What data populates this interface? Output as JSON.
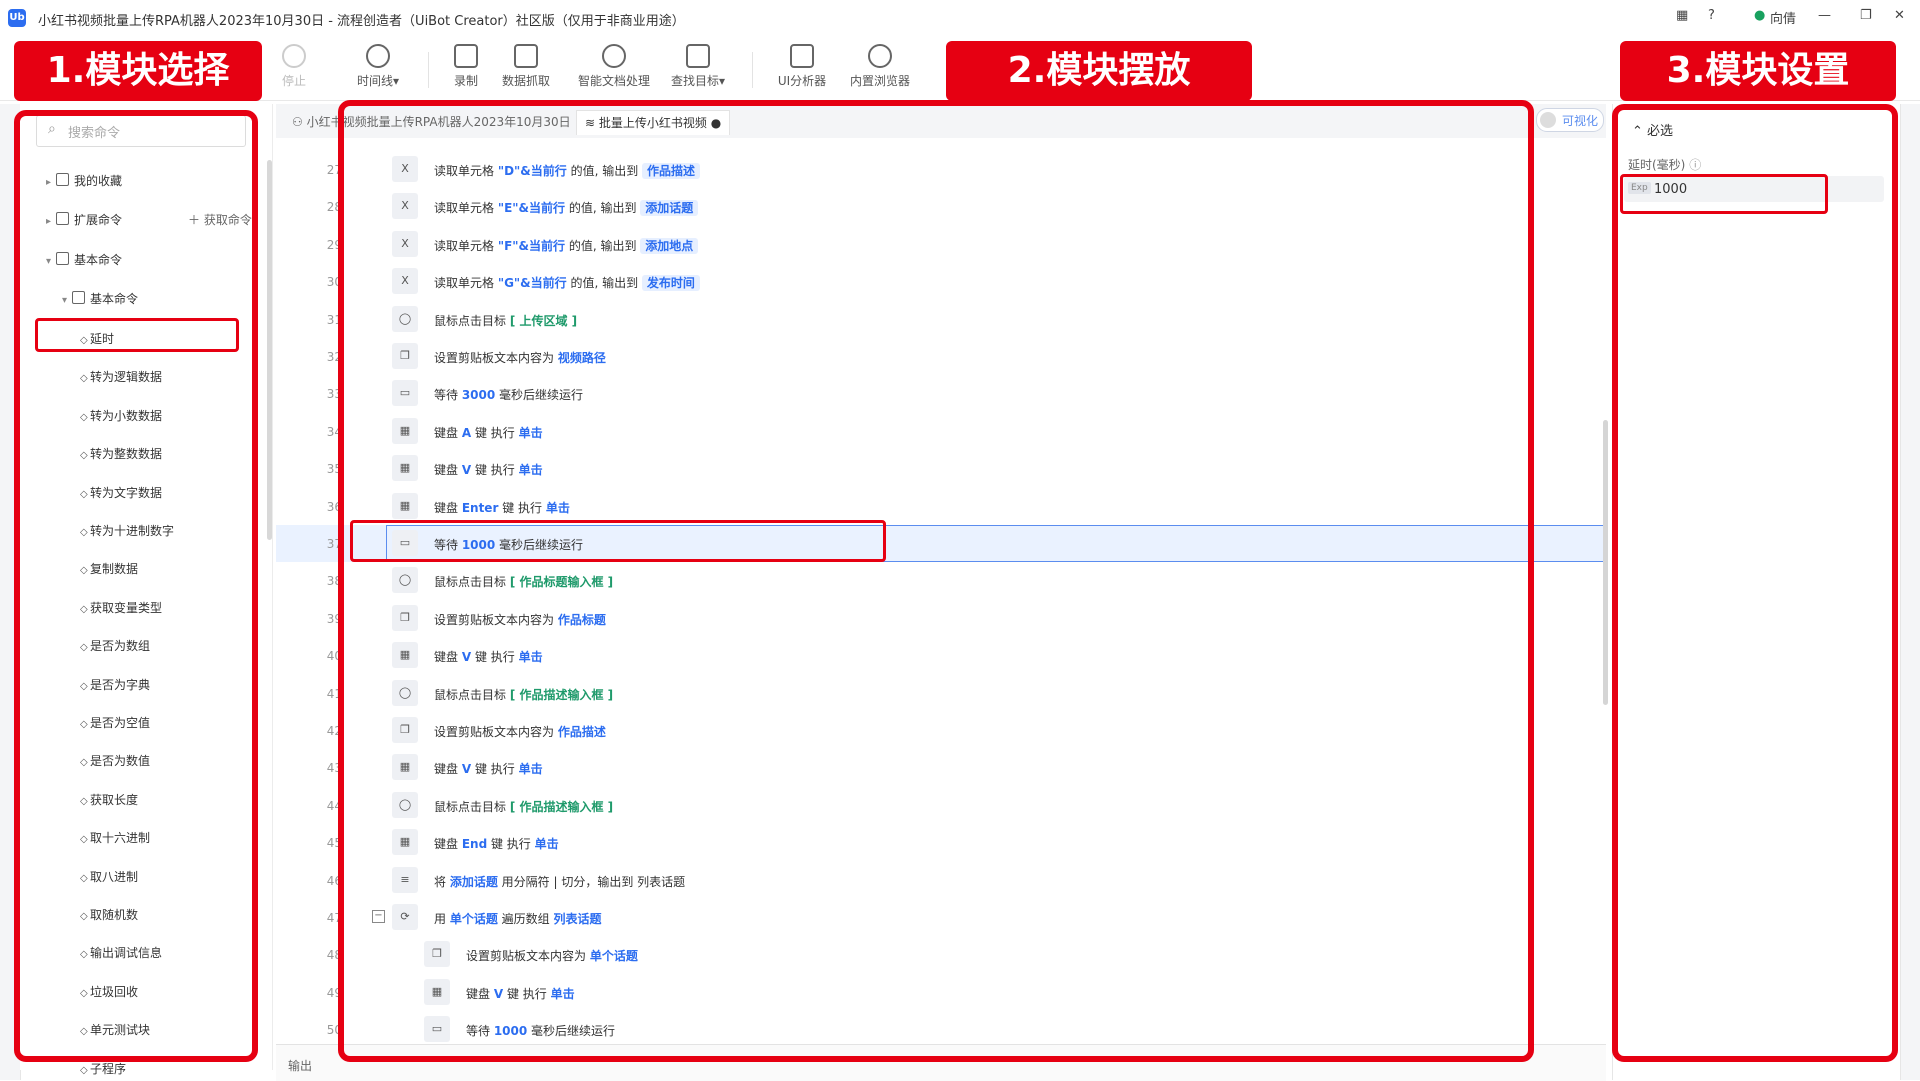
{
  "window": {
    "title": "小红书视频批量上传RPA机器人2023年10月30日 - 流程创造者（UiBot Creator）社区版（仅用于非商业用途）",
    "logo_text": "Ub",
    "user": "向倩"
  },
  "toolbar": {
    "items": [
      {
        "label": "停止",
        "icon": "stop-icon"
      },
      {
        "label": "时间线▾",
        "icon": "clock-icon"
      },
      {
        "label": "录制",
        "icon": "record-icon"
      },
      {
        "label": "数据抓取",
        "icon": "data-grab-icon"
      },
      {
        "label": "智能文档处理",
        "icon": "ai-doc-icon"
      },
      {
        "label": "查找目标▾",
        "icon": "find-target-icon"
      },
      {
        "label": "UI分析器",
        "icon": "ui-analyzer-icon"
      },
      {
        "label": "内置浏览器",
        "icon": "browser-icon"
      }
    ]
  },
  "annotations": {
    "section1": "1.模块选择",
    "section2": "2.模块摆放",
    "section3": "3.模块设置"
  },
  "left_panel": {
    "search_placeholder": "搜索命令",
    "favorites": "我的收藏",
    "extensions": "扩展命令",
    "get_command": "获取命令",
    "basic_root": "基本命令",
    "basic_sub": "基本命令",
    "commands": [
      "延时",
      "转为逻辑数据",
      "转为小数数据",
      "转为整数数据",
      "转为文字数据",
      "转为十进制数字",
      "复制数据",
      "获取变量类型",
      "是否为数组",
      "是否为字典",
      "是否为空值",
      "是否为数值",
      "获取长度",
      "取十六进制",
      "取八进制",
      "取随机数",
      "输出调试信息",
      "垃圾回收",
      "单元测试块",
      "子程序"
    ]
  },
  "tabs": [
    {
      "label": "小红书视频批量上传RPA机器人2023年10月30日"
    },
    {
      "label": "批量上传小红书视频 ●"
    }
  ],
  "visual_toggle": "可视化",
  "output_label": "输出",
  "editor": {
    "rows": [
      {
        "n": "27",
        "icon": "excel-icon",
        "parts": [
          [
            "t",
            "读取单元格 "
          ],
          [
            "v",
            "\"D\"&当前行"
          ],
          [
            "t",
            " 的值, 输出到 "
          ],
          [
            "p",
            "作品描述"
          ]
        ]
      },
      {
        "n": "28",
        "icon": "excel-icon",
        "parts": [
          [
            "t",
            "读取单元格 "
          ],
          [
            "v",
            "\"E\"&当前行"
          ],
          [
            "t",
            " 的值, 输出到 "
          ],
          [
            "p",
            "添加话题"
          ]
        ]
      },
      {
        "n": "29",
        "icon": "excel-icon",
        "parts": [
          [
            "t",
            "读取单元格 "
          ],
          [
            "v",
            "\"F\"&当前行"
          ],
          [
            "t",
            " 的值, 输出到 "
          ],
          [
            "p",
            "添加地点"
          ]
        ]
      },
      {
        "n": "30",
        "icon": "excel-icon",
        "parts": [
          [
            "t",
            "读取单元格 "
          ],
          [
            "v",
            "\"G\"&当前行"
          ],
          [
            "t",
            " 的值, 输出到 "
          ],
          [
            "p",
            "发布时间"
          ]
        ]
      },
      {
        "n": "31",
        "icon": "mouse-icon",
        "parts": [
          [
            "t",
            "鼠标点击目标 "
          ],
          [
            "g",
            "[ 上传区域 ]"
          ]
        ]
      },
      {
        "n": "32",
        "icon": "clipboard-icon",
        "parts": [
          [
            "t",
            "设置剪贴板文本内容为 "
          ],
          [
            "v",
            "视频路径"
          ]
        ]
      },
      {
        "n": "33",
        "icon": "wait-icon",
        "parts": [
          [
            "t",
            "等待 "
          ],
          [
            "v",
            "3000"
          ],
          [
            "t",
            " 毫秒后继续运行"
          ]
        ]
      },
      {
        "n": "34",
        "icon": "keyboard-icon",
        "parts": [
          [
            "t",
            "键盘 "
          ],
          [
            "v",
            "A"
          ],
          [
            "t",
            " 键 执行 "
          ],
          [
            "v",
            "单击"
          ]
        ]
      },
      {
        "n": "35",
        "icon": "keyboard-icon",
        "parts": [
          [
            "t",
            "键盘 "
          ],
          [
            "v",
            "V"
          ],
          [
            "t",
            " 键 执行 "
          ],
          [
            "v",
            "单击"
          ]
        ]
      },
      {
        "n": "36",
        "icon": "keyboard-icon",
        "parts": [
          [
            "t",
            "键盘 "
          ],
          [
            "v",
            "Enter"
          ],
          [
            "t",
            " 键 执行 "
          ],
          [
            "v",
            "单击"
          ]
        ]
      },
      {
        "n": "37",
        "icon": "wait-icon",
        "parts": [
          [
            "t",
            "等待 "
          ],
          [
            "v",
            "1000"
          ],
          [
            "t",
            " 毫秒后继续运行"
          ]
        ],
        "selected": true
      },
      {
        "n": "38",
        "icon": "mouse-icon",
        "parts": [
          [
            "t",
            "鼠标点击目标 "
          ],
          [
            "g",
            "[ 作品标题输入框 ]"
          ]
        ]
      },
      {
        "n": "39",
        "icon": "clipboard-icon",
        "parts": [
          [
            "t",
            "设置剪贴板文本内容为 "
          ],
          [
            "v",
            "作品标题"
          ]
        ]
      },
      {
        "n": "40",
        "icon": "keyboard-icon",
        "parts": [
          [
            "t",
            "键盘 "
          ],
          [
            "v",
            "V"
          ],
          [
            "t",
            " 键 执行 "
          ],
          [
            "v",
            "单击"
          ]
        ]
      },
      {
        "n": "41",
        "icon": "mouse-icon",
        "parts": [
          [
            "t",
            "鼠标点击目标 "
          ],
          [
            "g",
            "[ 作品描述输入框 ]"
          ]
        ]
      },
      {
        "n": "42",
        "icon": "clipboard-icon",
        "parts": [
          [
            "t",
            "设置剪贴板文本内容为 "
          ],
          [
            "v",
            "作品描述"
          ]
        ]
      },
      {
        "n": "43",
        "icon": "keyboard-icon",
        "parts": [
          [
            "t",
            "键盘 "
          ],
          [
            "v",
            "V"
          ],
          [
            "t",
            " 键 执行 "
          ],
          [
            "v",
            "单击"
          ]
        ]
      },
      {
        "n": "44",
        "icon": "mouse-icon",
        "parts": [
          [
            "t",
            "鼠标点击目标 "
          ],
          [
            "g",
            "[ 作品描述输入框 ]"
          ]
        ]
      },
      {
        "n": "45",
        "icon": "keyboard-icon",
        "parts": [
          [
            "t",
            "键盘 "
          ],
          [
            "v",
            "End"
          ],
          [
            "t",
            " 键 执行 "
          ],
          [
            "v",
            "单击"
          ]
        ]
      },
      {
        "n": "46",
        "icon": "split-icon",
        "parts": [
          [
            "t",
            "将 "
          ],
          [
            "v",
            "添加话题"
          ],
          [
            "t",
            " 用分隔符 | 切分，输出到 列表话题"
          ]
        ]
      },
      {
        "n": "47",
        "icon": "loop-icon",
        "parts": [
          [
            "t",
            "用 "
          ],
          [
            "v",
            "单个话题"
          ],
          [
            "t",
            " 遍历数组 "
          ],
          [
            "v",
            "列表话题"
          ]
        ],
        "fold": true
      },
      {
        "n": "48",
        "icon": "clipboard-icon",
        "parts": [
          [
            "t",
            "设置剪贴板文本内容为 "
          ],
          [
            "v",
            "单个话题"
          ]
        ],
        "indent": true
      },
      {
        "n": "49",
        "icon": "keyboard-icon",
        "parts": [
          [
            "t",
            "键盘 "
          ],
          [
            "v",
            "V"
          ],
          [
            "t",
            " 键 执行 "
          ],
          [
            "v",
            "单击"
          ]
        ],
        "indent": true
      },
      {
        "n": "50",
        "icon": "wait-icon",
        "parts": [
          [
            "t",
            "等待 "
          ],
          [
            "v",
            "1000"
          ],
          [
            "t",
            " 毫秒后继续运行"
          ]
        ],
        "indent": true
      }
    ]
  },
  "right_panel": {
    "section": "必选",
    "delay_label": "延时(毫秒)",
    "exp_tag": "Exp",
    "delay_value": "1000"
  }
}
